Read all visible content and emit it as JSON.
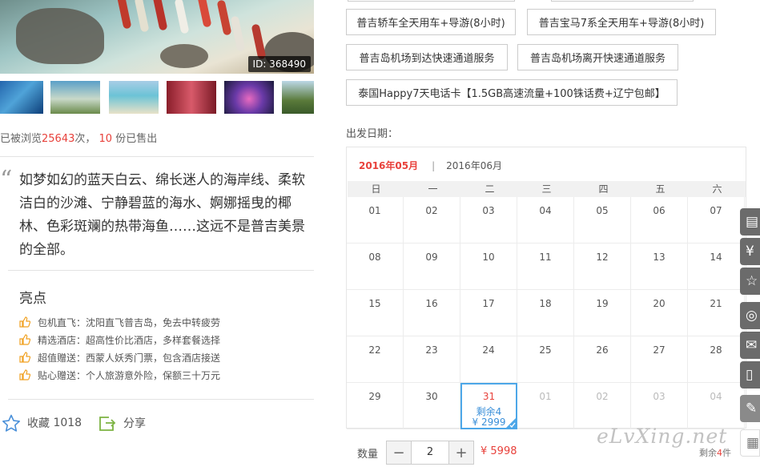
{
  "gallery": {
    "image_id": "ID: 368490",
    "thumbnails": [
      "thumb-1",
      "thumb-2",
      "thumb-3",
      "thumb-4",
      "thumb-5",
      "thumb-6"
    ]
  },
  "stats": {
    "prefix": "已被浏览",
    "views": "25643",
    "mid": "次，",
    "sold": "10",
    "suffix": "份已售出"
  },
  "description": "如梦如幻的蓝天白云、绵长迷人的海岸线、柔软洁白的沙滩、宁静碧蓝的海水、婀娜摇曳的椰林、色彩斑斓的热带海鱼……这远不是普吉美景的全部。",
  "highlights": {
    "title": "亮点",
    "items": [
      {
        "label": "包机直飞",
        "text": "：沈阳直飞普吉岛，免去中转疲劳"
      },
      {
        "label": "精选酒店",
        "text": "：超高性价比酒店，多样套餐选择"
      },
      {
        "label": "超值赠送",
        "text": "：西蒙人妖秀门票，包含酒店接送"
      },
      {
        "label": "贴心赠送",
        "text": "：个人旅游意外险，保额三十万元"
      }
    ]
  },
  "actions": {
    "favorite_label": "收藏",
    "favorite_count": "1018",
    "share_label": "分享"
  },
  "options": [
    "普吉轿车全天用车+导游(8小时)",
    "普吉宝马7系全天用车+导游(8小时)",
    "普吉岛机场到达快速通道服务",
    "普吉岛机场离开快速通道服务",
    "泰国Happy7天电话卡【1.5GB高速流量+100铢话费+辽宁包邮】"
  ],
  "departure_label": "出发日期：",
  "calendar": {
    "months": [
      "2016年05月",
      "2016年06月"
    ],
    "separator": "|",
    "weekdays": [
      "日",
      "一",
      "二",
      "三",
      "四",
      "五",
      "六"
    ],
    "rows": [
      [
        "01",
        "02",
        "03",
        "04",
        "05",
        "06",
        "07"
      ],
      [
        "08",
        "09",
        "10",
        "11",
        "12",
        "13",
        "14"
      ],
      [
        "15",
        "16",
        "17",
        "18",
        "19",
        "20",
        "21"
      ],
      [
        "22",
        "23",
        "24",
        "25",
        "26",
        "27",
        "28"
      ],
      [
        "29",
        "30",
        "31",
        "01",
        "02",
        "03",
        "04"
      ]
    ],
    "selected": {
      "remain": "剩余4",
      "price": "¥ 2999"
    }
  },
  "quantity": {
    "label": "数量",
    "minus": "−",
    "value": "2",
    "plus": "+",
    "total": "¥ 5998"
  },
  "watermark": "eLvXing.net",
  "remain_tail": {
    "prefix": "剩余",
    "count": "4",
    "suffix": "件"
  },
  "colors": {
    "accent": "#e8413b",
    "selection": "#4da7e8",
    "highlight_icon": "#f0a020"
  }
}
